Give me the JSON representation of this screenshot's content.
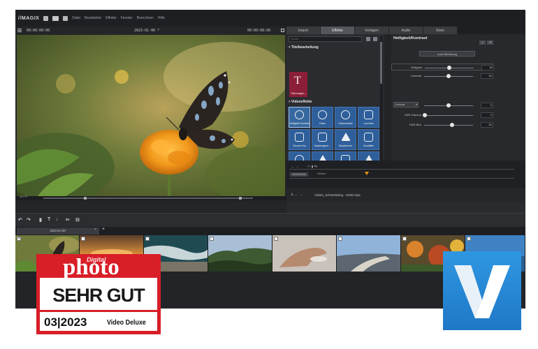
{
  "app": {
    "brand": "//MAGIX",
    "menu": [
      "Datei",
      "Bearbeiten",
      "Effekte",
      "Fenster",
      "Berechnen",
      "Hilfe"
    ]
  },
  "preview": {
    "timecode_start": "00:00:00:00",
    "project_title": "2023-01-06 *",
    "timecode_end": "00:00:08:00",
    "mute_label": "MUTE"
  },
  "transport": {
    "controls": [
      "[",
      "]",
      "[←",
      "|◂",
      "▶",
      "▸|",
      "→]"
    ]
  },
  "tabs": [
    {
      "label": "Import",
      "active": false
    },
    {
      "label": "Effekte",
      "active": true
    },
    {
      "label": "Vorlagen",
      "active": false
    },
    {
      "label": "Audio",
      "active": false
    },
    {
      "label": "Store",
      "active": false
    }
  ],
  "effects_panel": {
    "search_placeholder": "Suche",
    "group_titles": "Titelbearbeitung",
    "title_tile_label": "Titelvorlagen...",
    "group_video": "Videoeffekte",
    "effects": [
      {
        "label": "Helligkeit/ Kontrast",
        "icon": "sun-icon",
        "selected": true
      },
      {
        "label": "Farbe",
        "icon": "palette-icon",
        "selected": false
      },
      {
        "label": "Farbkorrektur",
        "icon": "color-wheel-icon",
        "selected": false
      },
      {
        "label": "Leuchten",
        "icon": "glow-icon",
        "selected": false
      },
      {
        "label": "Chroma Key",
        "icon": "chroma-key-icon",
        "selected": false
      },
      {
        "label": "Maskengener...",
        "icon": "mask-icon",
        "selected": false
      },
      {
        "label": "Stanzformen",
        "icon": "shape-icon",
        "selected": false
      },
      {
        "label": "Kunstfilter",
        "icon": "art-filter-icon",
        "selected": false
      },
      {
        "label": "VEGAS Video-stabilisieren",
        "icon": "stabilize-icon",
        "selected": false
      },
      {
        "label": "Unschärfe/ Bewegung",
        "icon": "blur-icon",
        "selected": false
      },
      {
        "label": "Verzerrung",
        "icon": "distortion-icon",
        "selected": false
      },
      {
        "label": "Schärfe",
        "icon": "sharpen-icon",
        "selected": false
      },
      {
        "label": "",
        "icon": "drop-icon",
        "selected": false
      },
      {
        "label": "",
        "icon": "film-icon",
        "selected": false
      },
      {
        "label": "",
        "icon": "fx-icon",
        "selected": false
      },
      {
        "label": "",
        "icon": "hexagon-icon",
        "selected": false
      }
    ]
  },
  "properties": {
    "title": "Helligkeit/Kontrast",
    "auto_button": "Auto Belichtung",
    "rows": [
      {
        "label": "Helligkeit",
        "value": "50",
        "level": 0.5
      },
      {
        "label": "Kontrast",
        "value": "50",
        "level": 0.5
      },
      {
        "label": "",
        "value": "0",
        "level": 0.5
      },
      {
        "label": "HDR-Gamma",
        "value": "0",
        "level": 0.0
      },
      {
        "label": "HDR-Blur",
        "value": "50",
        "level": 0.55
      }
    ],
    "contrast_mode": "Kontrast"
  },
  "rtimeline": {
    "timecode": "00:00:00:00",
    "rate": "Default  ◔",
    "file_info": "AVideo_Schmetterling - 12063.mp4"
  },
  "timeline_tab": {
    "label": "2023-01-06*"
  },
  "storyboard": {
    "clips": [
      {
        "name": "butterfly-clip",
        "checked": true
      },
      {
        "name": "sunset-clip",
        "checked": false
      },
      {
        "name": "ocean-waves-clip",
        "checked": false
      },
      {
        "name": "forest-hills-clip",
        "checked": false
      },
      {
        "name": "hand-water-clip",
        "checked": false
      },
      {
        "name": "coast-path-clip",
        "checked": false
      },
      {
        "name": "autumn-flowers-clip",
        "checked": false
      },
      {
        "name": "lake-clip",
        "checked": false
      }
    ]
  },
  "badge": {
    "magazine_digital": "Digital",
    "magazine_name": "photo",
    "rating": "SEHR GUT",
    "issue": "03|2023",
    "product": "Video Deluxe",
    "color": "#d81e27"
  },
  "logo": {
    "letter": "V",
    "color": "#2a8fdc"
  }
}
